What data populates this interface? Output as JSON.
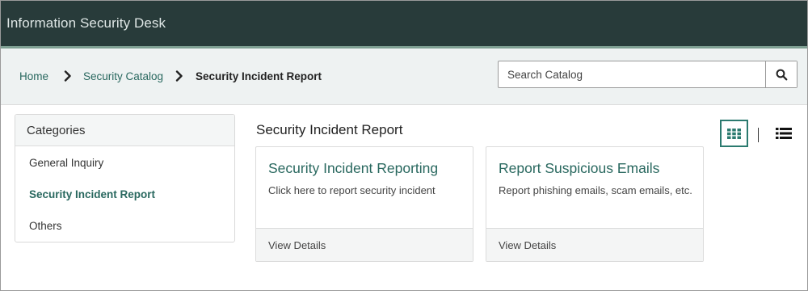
{
  "header": {
    "title": "Information Security Desk"
  },
  "breadcrumb": {
    "items": [
      {
        "label": "Home"
      },
      {
        "label": "Security Catalog"
      },
      {
        "label": "Security Incident Report"
      }
    ]
  },
  "search": {
    "placeholder": "Search Catalog",
    "value": "",
    "icon": "search-icon"
  },
  "categories": {
    "title": "Categories",
    "items": [
      {
        "label": "General Inquiry",
        "active": false
      },
      {
        "label": "Security Incident Report",
        "active": true
      },
      {
        "label": "Others",
        "active": false
      }
    ]
  },
  "main": {
    "title": "Security Incident Report",
    "view_toggle": {
      "grid_icon": "grid-view-icon",
      "list_icon": "list-view-icon",
      "selected": "grid"
    },
    "cards": [
      {
        "title": "Security Incident Reporting",
        "description": "Click here to report security incident",
        "footer": "View Details"
      },
      {
        "title": "Report Suspicious Emails",
        "description": "Report phishing emails, scam emails, etc.",
        "footer": "View Details"
      }
    ]
  },
  "colors": {
    "header_bg": "#283b3a",
    "accent": "#29685f",
    "band_bg": "#eef2f2"
  }
}
